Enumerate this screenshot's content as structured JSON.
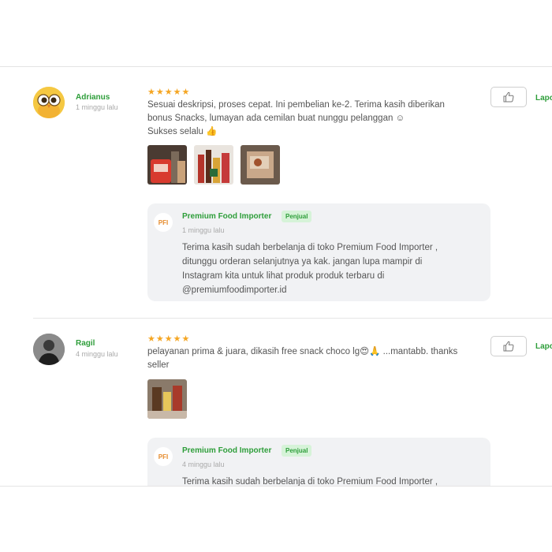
{
  "reviews": [
    {
      "username": "Adrianus",
      "time": "1 minggu lalu",
      "stars": "★★★★★",
      "text_lines": [
        "Sesuai deskripsi, proses cepat. Ini pembelian ke-2. Terima kasih diberikan",
        "bonus Snacks, lumayan ada cemilan buat nunggu pelanggan ☺",
        "Sukses selalu 👍"
      ],
      "like_icon": "thumbs-up-icon",
      "report_label": "Lapo",
      "reply": {
        "seller_logo": "PFI",
        "seller_name": "Premium Food Importer",
        "seller_badge": "Penjual",
        "time": "1 minggu lalu",
        "text_lines": [
          "Terima kasih sudah berbelanja di toko Premium Food Importer ,",
          "ditunggu orderan selanjutnya ya kak. jangan lupa mampir di",
          "Instagram kita untuk lihat produk produk terbaru di",
          "@premiumfoodimporter.id"
        ]
      }
    },
    {
      "username": "Ragil",
      "time": "4 minggu lalu",
      "stars": "★★★★★",
      "text_lines": [
        "pelayanan prima & juara, dikasih free snack choco lg😍🙏 ...mantabb. thanks",
        "seller"
      ],
      "like_icon": "thumbs-up-icon",
      "report_label": "Lapo",
      "reply": {
        "seller_logo": "PFI",
        "seller_name": "Premium Food Importer",
        "seller_badge": "Penjual",
        "time": "4 minggu lalu",
        "text_lines": [
          "Terima kasih sudah berbelanja di toko Premium Food Importer ,"
        ]
      }
    }
  ]
}
